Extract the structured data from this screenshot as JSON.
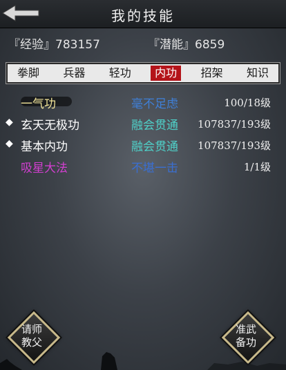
{
  "header": {
    "title": "我的技能"
  },
  "stats": {
    "exp_label": "『经验』",
    "exp_value": "783157",
    "potential_label": "『潜能』",
    "potential_value": "6859"
  },
  "tabs": [
    {
      "label": "拳脚",
      "active": false
    },
    {
      "label": "兵器",
      "active": false
    },
    {
      "label": "轻功",
      "active": false
    },
    {
      "label": "内功",
      "active": true
    },
    {
      "label": "招架",
      "active": false
    },
    {
      "label": "知识",
      "active": false
    }
  ],
  "skills": [
    {
      "bullet": "",
      "name": "一气功",
      "name_color": "#f2e59a",
      "grade": "毫不足虑",
      "grade_color": "#3f7fd6",
      "level": "100/18级"
    },
    {
      "bullet": "◆",
      "name": "玄天无极功",
      "name_color": "#ffffff",
      "grade": "融会贯通",
      "grade_color": "#4fd0c8",
      "level": "107837/193级"
    },
    {
      "bullet": "◆",
      "name": "基本内功",
      "name_color": "#ffffff",
      "grade": "融会贯通",
      "grade_color": "#4fd0c8",
      "level": "107837/193级"
    },
    {
      "bullet": "",
      "name": "吸星大法",
      "name_color": "#d23fd0",
      "grade": "不堪一击",
      "grade_color": "#3a6fd2",
      "level": "1/1级"
    }
  ],
  "buttons": {
    "left_line1": "请师",
    "left_line2": "教父",
    "right_line1": "准武",
    "right_line2": "备功"
  },
  "colors": {
    "tab_active": "#b4141a",
    "tab_bg": "#e9e9e9",
    "button_border": "#c8b98a"
  },
  "icons": {
    "back": "back-arrow-icon",
    "bullet": "diamond-bullet-icon"
  }
}
